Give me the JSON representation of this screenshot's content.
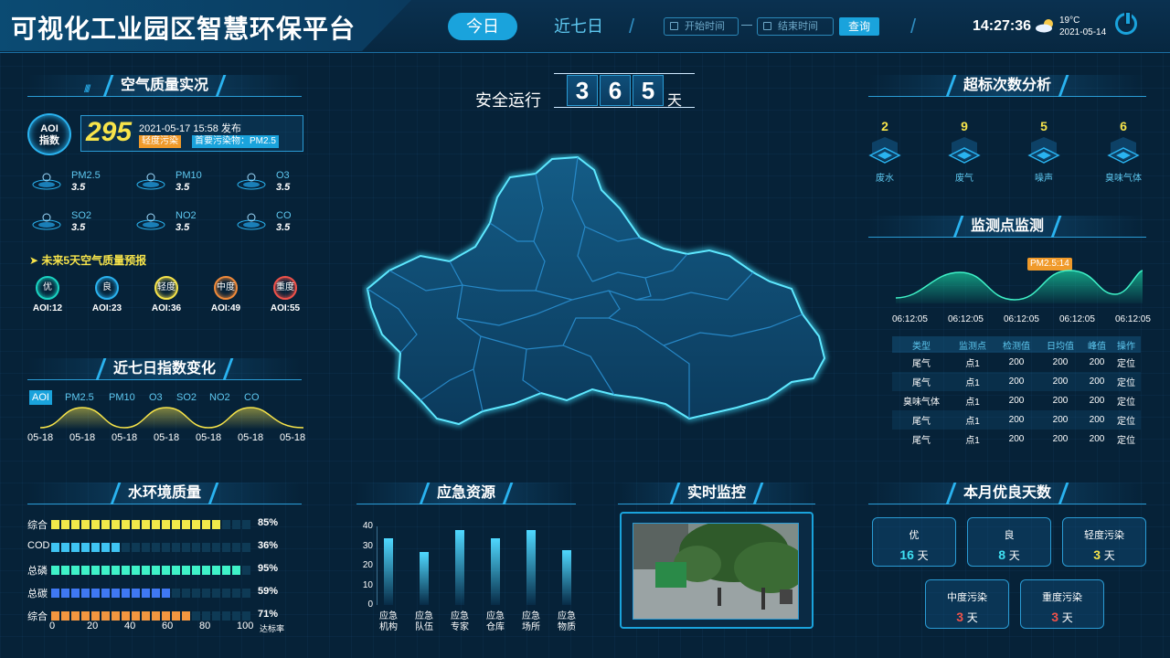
{
  "header": {
    "title": "可视化工业园区智慧环保平台",
    "today": "今日",
    "week": "近七日",
    "start_placeholder": "开始时间",
    "end_placeholder": "结束时间",
    "query": "查询",
    "time": "14:27:36",
    "temp": "19°C",
    "date": "2021-05-14"
  },
  "air": {
    "title": "空气质量实况",
    "badge_line1": "AOI",
    "badge_line2": "指数",
    "value": "295",
    "published": "2021-05-17 15:58 发布",
    "level": "轻度污染",
    "primary": "首要污染物：PM2.5",
    "pollutants": [
      {
        "name": "PM2.5",
        "value": "3.5"
      },
      {
        "name": "PM10",
        "value": "3.5"
      },
      {
        "name": "O3",
        "value": "3.5"
      },
      {
        "name": "SO2",
        "value": "3.5"
      },
      {
        "name": "NO2",
        "value": "3.5"
      },
      {
        "name": "CO",
        "value": "3.5"
      }
    ],
    "forecast_title": "未来5天空气质量预报",
    "forecast": [
      {
        "level": "优",
        "aqi": "AOI:12",
        "color": "#19d4c3"
      },
      {
        "level": "良",
        "aqi": "AOI:23",
        "color": "#2ab3f0"
      },
      {
        "level": "轻度",
        "aqi": "AOI:36",
        "color": "#f7e44a"
      },
      {
        "level": "中度",
        "aqi": "AOI:49",
        "color": "#f08a3a"
      },
      {
        "level": "重度",
        "aqi": "AOI:55",
        "color": "#f0524a"
      }
    ]
  },
  "trend": {
    "title": "近七日指数变化",
    "tabs": [
      "AOI",
      "PM2.5",
      "PM10",
      "O3",
      "SO2",
      "NO2",
      "CO"
    ],
    "xlabels": [
      "05-18",
      "05-18",
      "05-18",
      "05-18",
      "05-18",
      "05-18",
      "05-18"
    ]
  },
  "water": {
    "title": "水环境质量",
    "rows": [
      {
        "label": "综合",
        "pct": "85%",
        "color": "#f2e94a",
        "value": 85
      },
      {
        "label": "COD",
        "pct": "36%",
        "color": "#3fc4f2",
        "value": 36
      },
      {
        "label": "总磷",
        "pct": "95%",
        "color": "#3ff2c8",
        "value": 95
      },
      {
        "label": "总碳",
        "pct": "59%",
        "color": "#3f78f2",
        "value": 59
      },
      {
        "label": "综合",
        "pct": "71%",
        "color": "#f2963f",
        "value": 71
      }
    ],
    "xticks": [
      "0",
      "20",
      "40",
      "60",
      "80",
      "100"
    ],
    "unit": "达标率"
  },
  "center": {
    "safe_label": "安全运行",
    "digits": [
      "3",
      "6",
      "5"
    ],
    "unit": "天"
  },
  "emergency": {
    "title": "应急资源",
    "yticks": [
      "40",
      "30",
      "20",
      "10",
      "0"
    ],
    "items": [
      {
        "l1": "应急",
        "l2": "机构",
        "value": 34
      },
      {
        "l1": "应急",
        "l2": "队伍",
        "value": 27
      },
      {
        "l1": "应急",
        "l2": "专家",
        "value": 38
      },
      {
        "l1": "应急",
        "l2": "仓库",
        "value": 34
      },
      {
        "l1": "应急",
        "l2": "场所",
        "value": 38
      },
      {
        "l1": "应急",
        "l2": "物质",
        "value": 28
      }
    ]
  },
  "video": {
    "title": "实时监控"
  },
  "exceed": {
    "title": "超标次数分析",
    "items": [
      {
        "count": "2",
        "label": "废水"
      },
      {
        "count": "9",
        "label": "废气"
      },
      {
        "count": "5",
        "label": "噪声"
      },
      {
        "count": "6",
        "label": "臭味气体"
      }
    ]
  },
  "monitor": {
    "title": "监测点监测",
    "tooltip": "PM2.5:14",
    "times": [
      "06:12:05",
      "06:12:05",
      "06:12:05",
      "06:12:05",
      "06:12:05"
    ],
    "headers": [
      "类型",
      "监测点",
      "检测值",
      "日均值",
      "峰值",
      "操作"
    ],
    "rows": [
      [
        "尾气",
        "点1",
        "200",
        "200",
        "200",
        "定位"
      ],
      [
        "尾气",
        "点1",
        "200",
        "200",
        "200",
        "定位"
      ],
      [
        "臭味气体",
        "点1",
        "200",
        "200",
        "200",
        "定位"
      ],
      [
        "尾气",
        "点1",
        "200",
        "200",
        "200",
        "定位"
      ],
      [
        "尾气",
        "点1",
        "200",
        "200",
        "200",
        "定位"
      ]
    ]
  },
  "good_days": {
    "title": "本月优良天数",
    "unit": "天",
    "items": [
      {
        "label": "优",
        "value": "16",
        "color": "#3fe0f2"
      },
      {
        "label": "良",
        "value": "8",
        "color": "#3fe0f2"
      },
      {
        "label": "轻度污染",
        "value": "3",
        "color": "#f7e44a"
      },
      {
        "label": "中度污染",
        "value": "3",
        "color": "#f0524a"
      },
      {
        "label": "重度污染",
        "value": "3",
        "color": "#f0524a"
      }
    ]
  }
}
